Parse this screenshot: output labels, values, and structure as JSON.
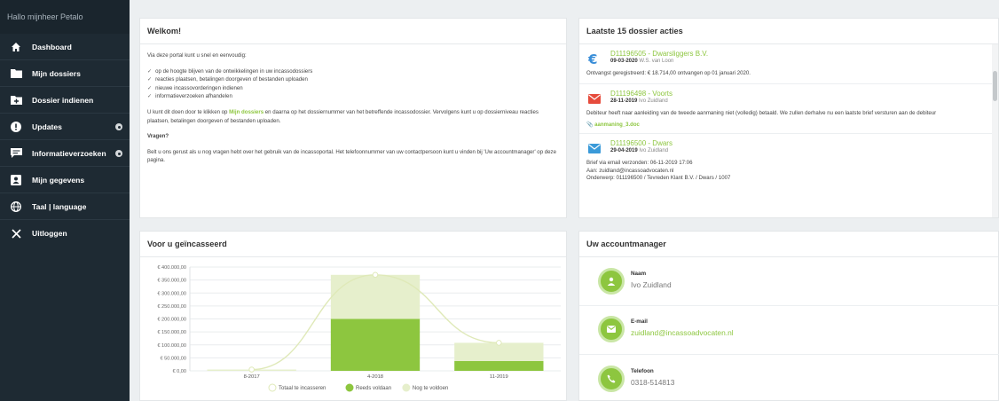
{
  "sidebar": {
    "greeting": "Hallo mijnheer Petalo",
    "items": [
      {
        "label": "Dashboard",
        "icon": "home-icon"
      },
      {
        "label": "Mijn dossiers",
        "icon": "folder-icon"
      },
      {
        "label": "Dossier indienen",
        "icon": "folder-plus-icon"
      },
      {
        "label": "Updates",
        "icon": "alert-icon"
      },
      {
        "label": "Informatieverzoeken",
        "icon": "comment-icon"
      },
      {
        "label": "Mijn gegevens",
        "icon": "user-card-icon"
      },
      {
        "label": "Taal | language",
        "icon": "globe-icon"
      },
      {
        "label": "Uitloggen",
        "icon": "close-icon"
      }
    ]
  },
  "welcome": {
    "title": "Welkom!",
    "intro": "Via deze portal kunt u snel en eenvoudig:",
    "bullets": [
      "op de hoogte blijven van de ontwikkelingen in uw incassodossiers",
      "reacties plaatsen, betalingen doorgeven of bestanden uploaden",
      "nieuwe incassovorderingen indienen",
      "informatieverzoeken afhandelen"
    ],
    "para_before": "U kunt dit doen door te klikken op ",
    "para_link": "Mijn dossiers",
    "para_after": " en daarna op het dossiernummer van het betreffende incassodossier. Vervolgens kunt u op dossierniveau reacties plaatsen, betalingen doorgeven of bestanden uploaden.",
    "questions_title": "Vragen?",
    "questions_text": "Belt u ons gerust als u nog vragen hebt over het gebruik van de incassoportal. Het telefoonnummer van uw contactpersoon kunt u vinden bij 'Uw accountmanager' op deze pagina."
  },
  "actions": {
    "title": "Laatste 15 dossier acties",
    "items": [
      {
        "icon": "euro-icon",
        "dossier": "D11196505 - Dwarsliggers B.V.",
        "date": "09-03-2020",
        "person": "W.S. van Loon",
        "text": "Ontvangst geregistreerd: € 18.714,00 ontvangen op 01 januari 2020."
      },
      {
        "icon": "mail-red-icon",
        "dossier": "D11196498 - Voorts",
        "date": "28-11-2019",
        "person": "Ivo Zuidland",
        "text": "Debiteur heeft naar aanleiding van de tweede aanmaning niet (volledig) betaald. We zullen derhalve nu een laatste brief versturen aan de debiteur",
        "attachment": "aanmaning_3.doc"
      },
      {
        "icon": "mail-blue-icon",
        "dossier": "D11196500 - Dwars",
        "date": "29-04-2019",
        "person": "Ivo Zuidland",
        "lines": [
          "Brief via email verzonden: 06-11-2019 17:06",
          "Aan: zuidland@incassoadvocaten.nl",
          "Onderwerp: 011196500 / Tevreden Klant B.V. / Dwars / 1007"
        ]
      }
    ]
  },
  "chart": {
    "title": "Voor u geïncasseerd",
    "chart_data": {
      "type": "bar",
      "categories": [
        "8-2017",
        "4-2018",
        "11-2019"
      ],
      "series": [
        {
          "name": "Totaal te incasseren",
          "kind": "line",
          "values": [
            5000,
            370000,
            108000
          ],
          "color": "#dfe9b8"
        },
        {
          "name": "Reeds voldaan",
          "kind": "bar",
          "values": [
            0,
            200000,
            38000
          ],
          "color": "#8dc63f"
        },
        {
          "name": "Nog te voldoen",
          "kind": "bar",
          "values": [
            5000,
            170000,
            70000
          ],
          "color": "#e6efcc"
        }
      ],
      "ylim": [
        0,
        400000
      ],
      "yticks": [
        "€ 0,00",
        "€ 50.000,00",
        "€ 100.000,00",
        "€ 150.000,00",
        "€ 200.000,00",
        "€ 250.000,00",
        "€ 300.000,00",
        "€ 350.000,00",
        "€ 400.000,00"
      ],
      "grid": true,
      "legend": "bottom"
    }
  },
  "manager": {
    "title": "Uw accountmanager",
    "rows": [
      {
        "label": "Naam",
        "value": "Ivo Zuidland",
        "icon": "user-icon"
      },
      {
        "label": "E-mail",
        "value": "zuidland@incassoadvocaten.nl",
        "icon": "mail-icon"
      },
      {
        "label": "Telefoon",
        "value": "0318-514813",
        "icon": "phone-icon"
      }
    ]
  }
}
